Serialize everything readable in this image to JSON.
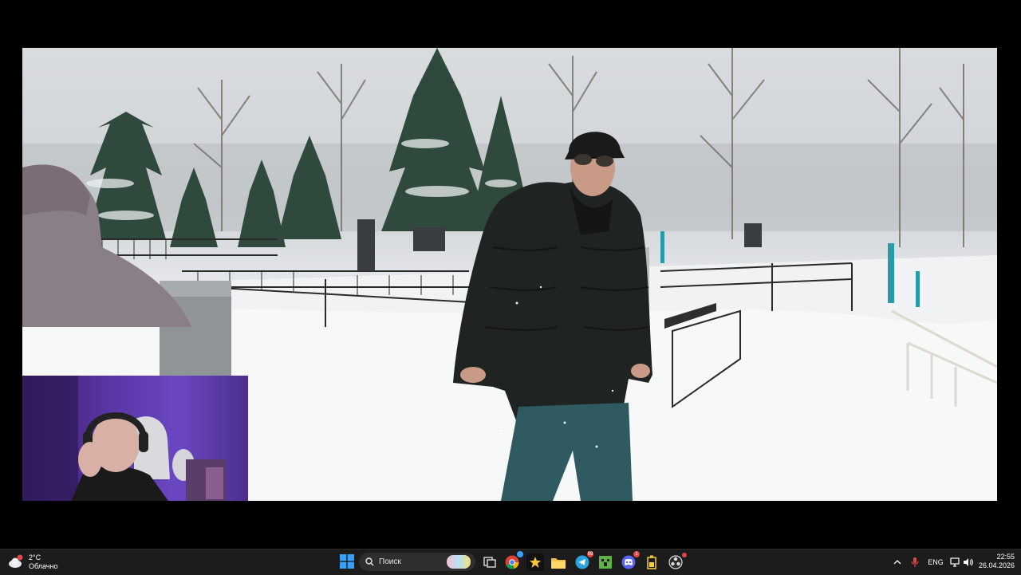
{
  "video": {
    "description_free": true
  },
  "taskbar": {
    "weather": {
      "temp": "2°C",
      "condition": "Облачно",
      "icon": "cloud-icon"
    },
    "search": {
      "placeholder": "Поиск"
    },
    "apps": [
      {
        "name": "chrome",
        "icon": "chrome-icon"
      },
      {
        "name": "app-yellow",
        "icon": "star-app-icon"
      },
      {
        "name": "explorer",
        "icon": "folder-icon"
      },
      {
        "name": "telegram",
        "icon": "telegram-icon",
        "badge": "99"
      },
      {
        "name": "minecraft",
        "icon": "minecraft-icon"
      },
      {
        "name": "discord",
        "icon": "discord-icon",
        "badge": "1"
      },
      {
        "name": "app-battery",
        "icon": "battery-app-icon"
      },
      {
        "name": "obs",
        "icon": "obs-icon"
      }
    ],
    "tray": {
      "language": "ENG"
    },
    "clock": {
      "time": "22:55",
      "date": "26.04.2026"
    },
    "colors": {
      "bar": "#1c1c1c",
      "accent": "#0a84ff",
      "badge": "#e04646"
    }
  }
}
